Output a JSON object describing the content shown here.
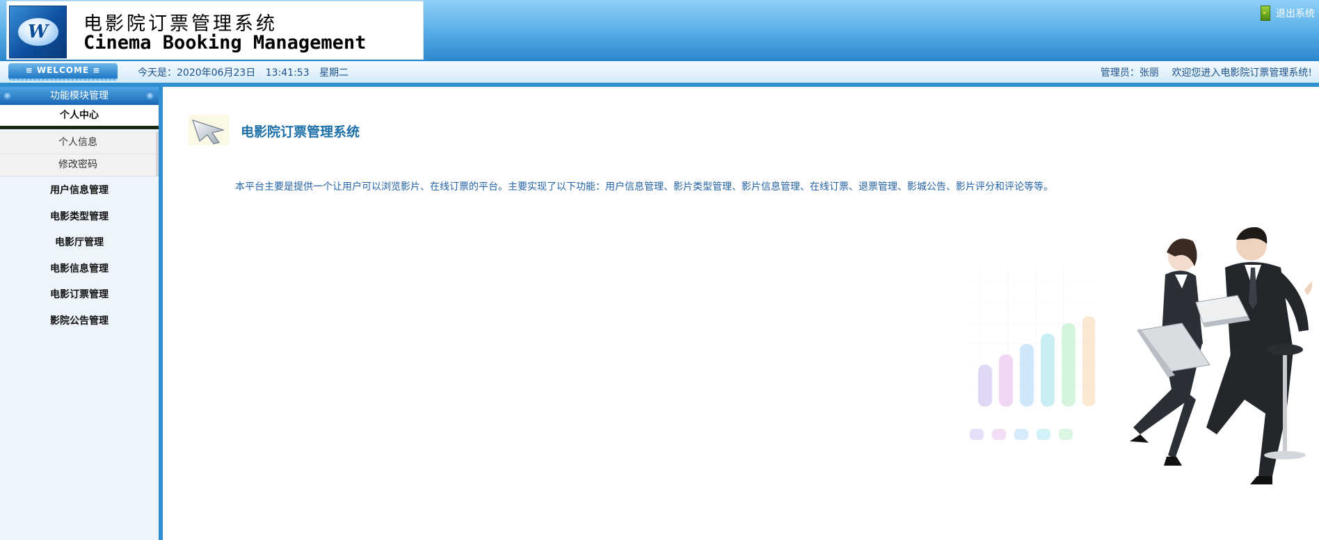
{
  "header": {
    "logo_icon": "w-logo-icon",
    "title_cn": "电影院订票管理系统",
    "title_en": "Cinema Booking Management",
    "logout_label": "退出系统",
    "logout_icon": "door-exit-icon"
  },
  "infobar": {
    "welcome": "≡ WELCOME ≡",
    "date_prefix": "今天是：2020年06月23日",
    "time": "13:41:53",
    "weekday": "星期二",
    "admin": "管理员：张丽",
    "welcome_msg": "欢迎您进入电影院订票管理系统!"
  },
  "sidebar": {
    "header": "功能模块管理",
    "group_title": "个人中心",
    "sub_items": [
      "个人信息",
      "修改密码"
    ],
    "items": [
      "用户信息管理",
      "电影类型管理",
      "电影厅管理",
      "电影信息管理",
      "电影订票管理",
      "影院公告管理"
    ]
  },
  "main": {
    "icon": "arrow-pointer-icon",
    "title": "电影院订票管理系统",
    "description": "本平台主要是提供一个让用户可以浏览影片、在线订票的平台。主要实现了以下功能：用户信息管理、影片类型管理、影片信息管理、在线订票、退票管理、影城公告、影片评分和评论等等。"
  },
  "colors": {
    "accent": "#2f8fd0",
    "title_blue": "#1d6fa8",
    "text_blue": "#2362a5"
  }
}
